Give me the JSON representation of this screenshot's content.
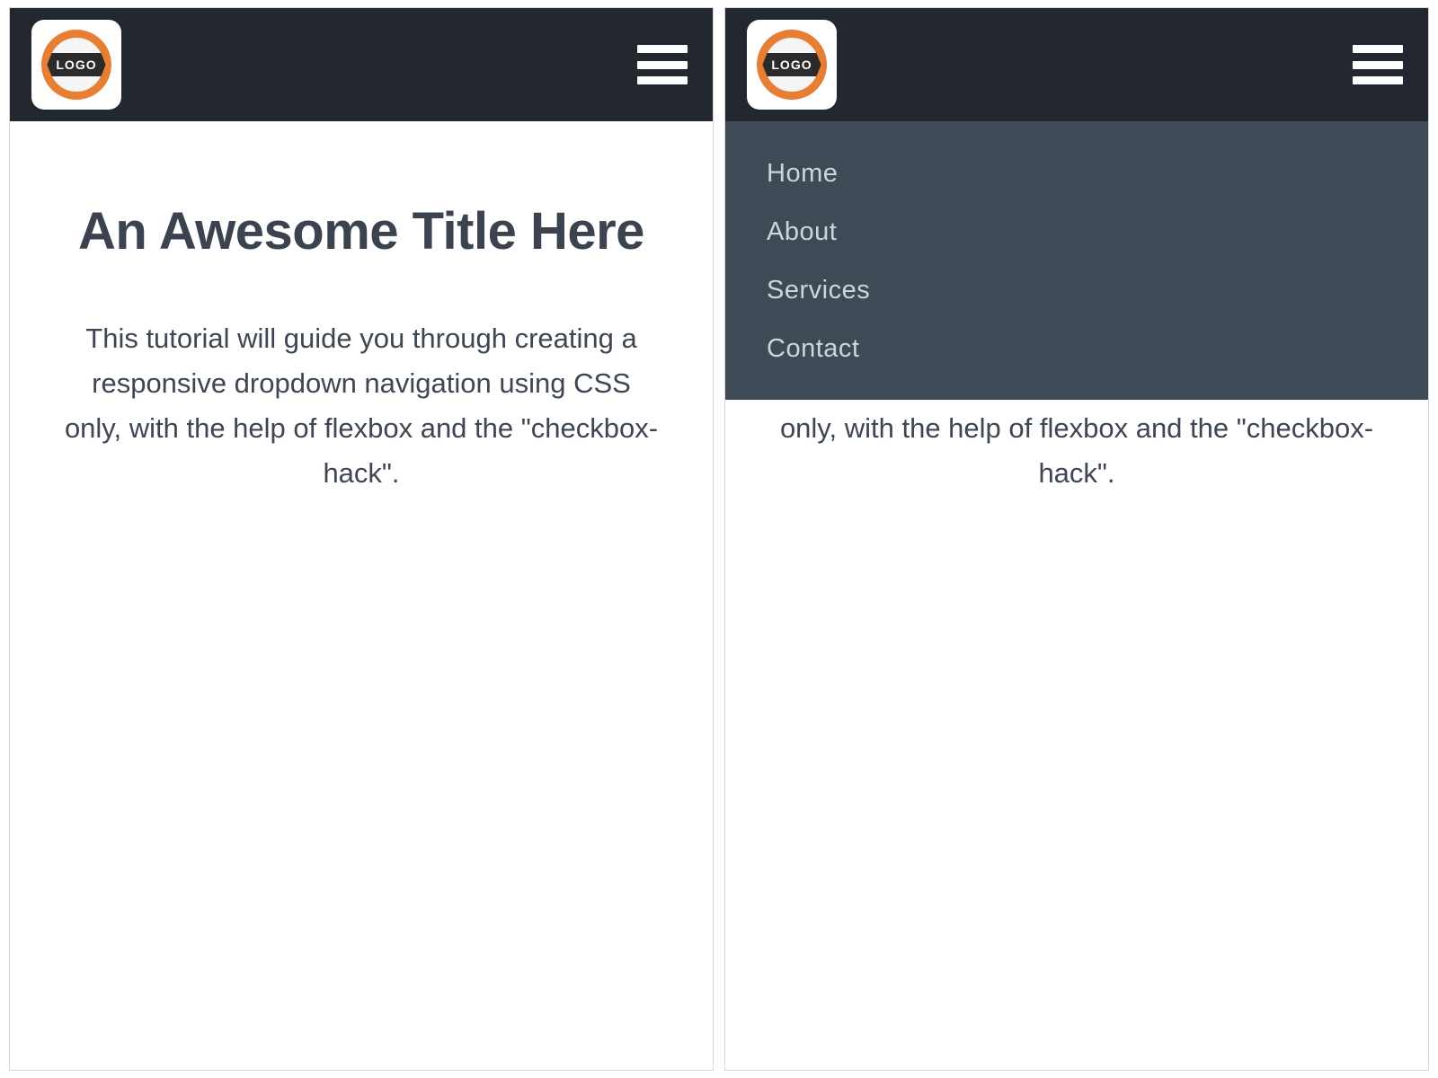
{
  "logo": {
    "text": "LOGO"
  },
  "nav": {
    "items": [
      {
        "label": "Home"
      },
      {
        "label": "About"
      },
      {
        "label": "Services"
      },
      {
        "label": "Contact"
      }
    ]
  },
  "content": {
    "title": "An Awesome Title Here",
    "body": "This tutorial will guide you through creating a responsive dropdown navigation using CSS only, with the help of flexbox and the \"checkbox-hack\"."
  }
}
